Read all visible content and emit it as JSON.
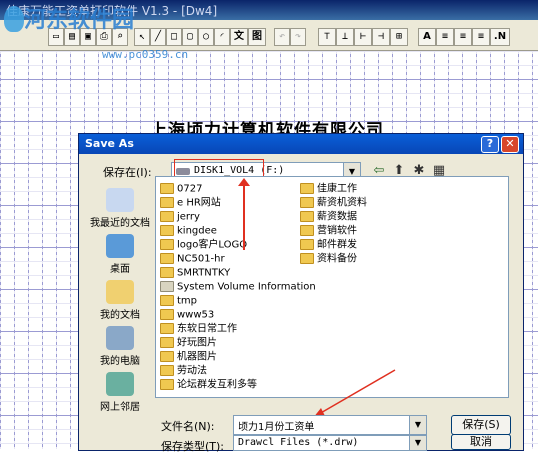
{
  "app": {
    "title": "佳康万能工资单打印软件 V1.3 - [Dw4]",
    "watermark": "河东软件园",
    "watermark_url": "www.pc0359.cn",
    "company_header": "上海顷力计算机软件有限公司",
    "toolbar_buttons": [
      "文",
      "图",
      "A",
      ".N"
    ]
  },
  "dialog": {
    "title": "Save As",
    "help_label": "?",
    "close_label": "✕",
    "save_in_label": "保存在(I):",
    "save_in_value": "DISK1_VOL4 (F:)",
    "places": [
      "我最近的文档",
      "桌面",
      "我的文档",
      "我的电脑",
      "网上邻居"
    ],
    "files_left": [
      "0727",
      "e HR网站",
      "jerry",
      "kingdee",
      "logo客户LOGO",
      "NC501-hr",
      "SMRTNTKY",
      "System Volume Information",
      "tmp",
      "www53",
      "东软日常工作",
      "好玩图片",
      "机器图片",
      "劳动法",
      "论坛群发互利多等"
    ],
    "files_right": [
      "佳康工作",
      "薪资机资料",
      "薪资数据",
      "营销软件",
      "邮件群发",
      "资料备份"
    ],
    "filename_label": "文件名(N):",
    "filename_value": "顷力1月份工资单",
    "filetype_label": "保存类型(T):",
    "filetype_value": "Drawcl Files (*.drw)",
    "save_button": "保存(S)",
    "cancel_button": "取消"
  },
  "colors": {
    "titlebar": "#0a5fd8",
    "dialog_bg": "#ece9d8",
    "annotation": "#e03020",
    "grid": "#4a4ab0"
  }
}
